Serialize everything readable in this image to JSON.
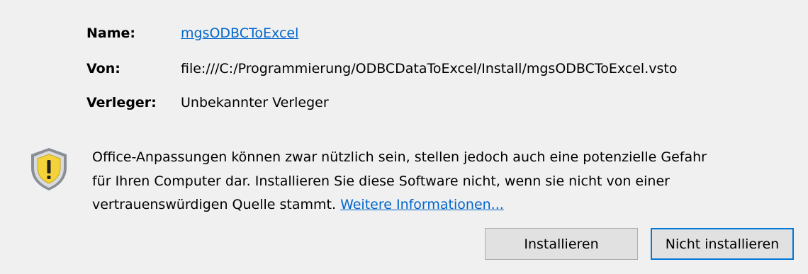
{
  "info": {
    "name_label": "Name:",
    "name_value": "mgsODBCToExcel",
    "from_label": "Von:",
    "from_value": "file:///C:/Programmierung/ODBCDataToExcel/Install/mgsODBCToExcel.vsto",
    "publisher_label": "Verleger:",
    "publisher_value": "Unbekannter Verleger"
  },
  "warning": {
    "icon": "warning-shield-icon",
    "line1": "Office-Anpassungen können zwar nützlich sein, stellen jedoch auch eine potenzielle Gefahr",
    "line2": "für Ihren Computer dar. Installieren Sie diese Software nicht, wenn sie nicht von einer",
    "line3_prefix": "vertrauenswürdigen Quelle stammt. ",
    "more_info_link": "Weitere Informationen..."
  },
  "buttons": {
    "install_label": "Installieren",
    "dont_install_label": "Nicht installieren"
  },
  "colors": {
    "background": "#f0f0f0",
    "link": "#0066cc",
    "button_face": "#e1e1e1",
    "button_border": "#adadad",
    "focus_border": "#0078d7",
    "shield_yellow": "#f3d23a",
    "shield_grey": "#8a8f96"
  }
}
